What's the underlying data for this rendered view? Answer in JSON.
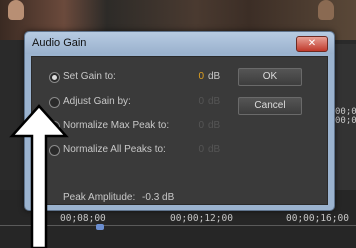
{
  "dialog": {
    "title": "Audio Gain",
    "close_label": "✕",
    "options": [
      {
        "label": "Set Gain to:",
        "value": "0",
        "unit": "dB",
        "selected": true
      },
      {
        "label": "Adjust Gain by:",
        "value": "0",
        "unit": "dB",
        "selected": false
      },
      {
        "label": "Normalize Max Peak to:",
        "value": "0",
        "unit": "dB",
        "selected": false
      },
      {
        "label": "Normalize All Peaks to:",
        "value": "0",
        "unit": "dB",
        "selected": false
      }
    ],
    "ok_label": "OK",
    "cancel_label": "Cancel",
    "peak_label": "Peak Amplitude:",
    "peak_value": "-0.3 dB"
  },
  "timeline": {
    "timecodes": [
      "00;08;00",
      "00;00;12;00",
      "00;00;16;00"
    ],
    "side_timecode_a": "00;00",
    "side_timecode_b": "00;00"
  },
  "colors": {
    "active_value": "#e0a020",
    "dialog_frame": "#9bb3cf",
    "close_button": "#c0392b"
  }
}
